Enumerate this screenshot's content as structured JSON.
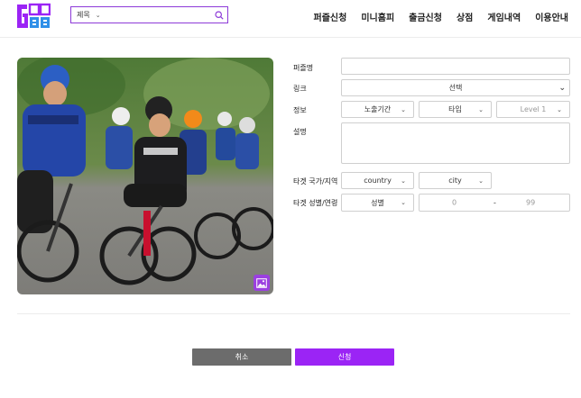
{
  "header": {
    "logo_icon": "gee-logo-icon",
    "search": {
      "category": "제목",
      "placeholder": "",
      "icon": "search-icon"
    },
    "nav": [
      "퍼즐신청",
      "미니홈피",
      "출금신청",
      "상점",
      "게임내역",
      "이용안내"
    ]
  },
  "form": {
    "labels": {
      "puzzle_name": "퍼즐명",
      "link": "링크",
      "info": "정보",
      "description": "설명",
      "target_region": "타겟 국가/지역",
      "target_gender_age": "타겟 성별/연령"
    },
    "puzzle_name_value": "",
    "link_select": "선택",
    "exposure_select": "노출기간",
    "type_select": "타입",
    "level_select": "Level 1",
    "description_value": "",
    "country_select": "country",
    "city_select": "city",
    "gender_select": "성별",
    "age_min": "0",
    "age_sep": "-",
    "age_max": "99"
  },
  "photo": {
    "badge_icon": "image-icon"
  },
  "buttons": {
    "cancel": "취소",
    "submit": "신청"
  },
  "colors": {
    "accent": "#9b24f5",
    "cancel": "#6c6c6c",
    "search_border": "#8d3ad8"
  }
}
